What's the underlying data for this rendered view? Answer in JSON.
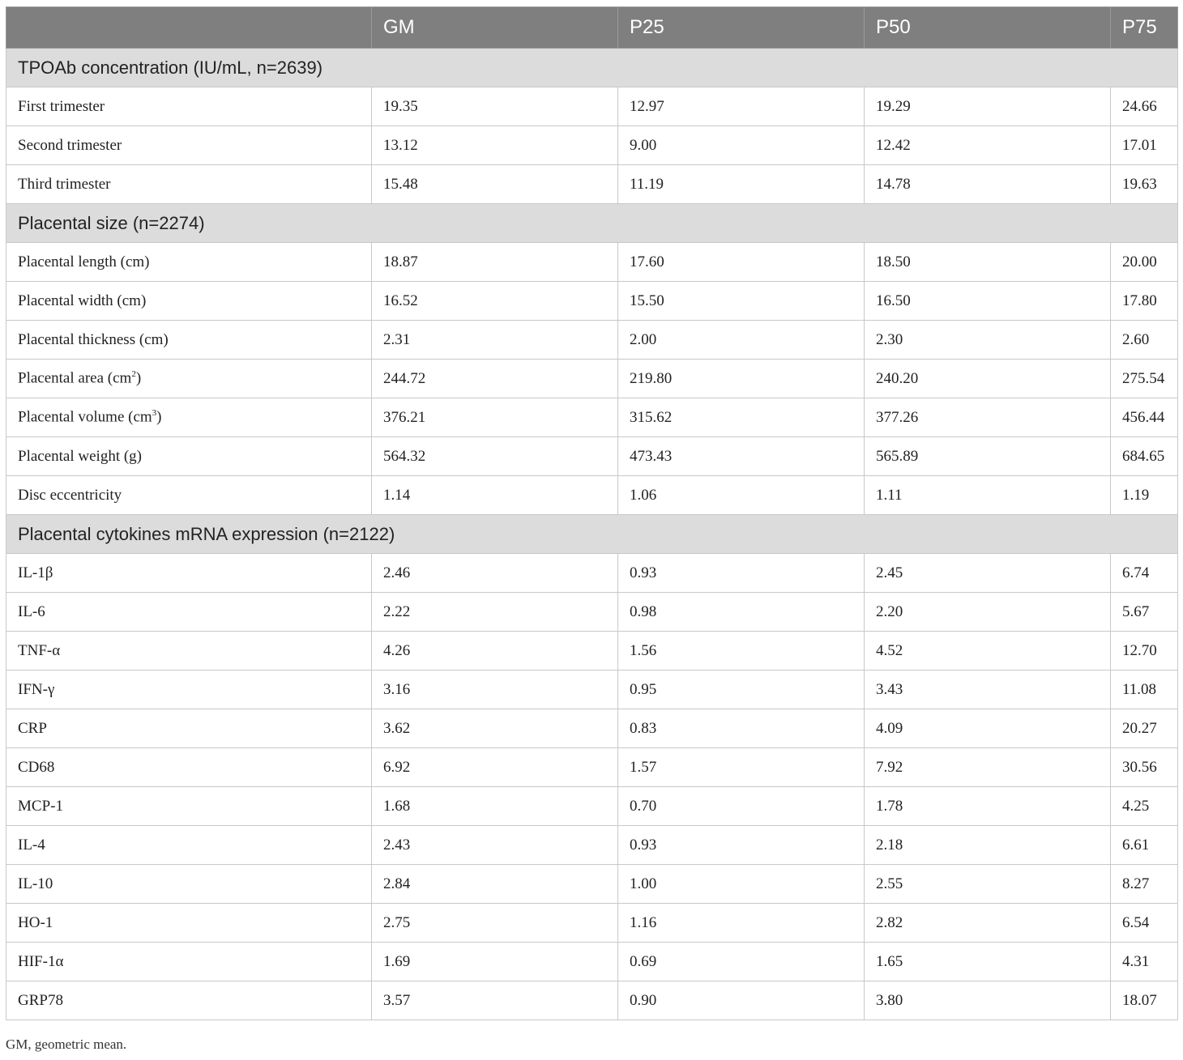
{
  "header": [
    "",
    "GM",
    "P25",
    "P50",
    "P75"
  ],
  "sections": [
    {
      "title": "TPOAb concentration (IU/mL, n=2639)",
      "rows": [
        {
          "label": "First trimester",
          "values": [
            "19.35",
            "12.97",
            "19.29",
            "24.66"
          ]
        },
        {
          "label": "Second trimester",
          "values": [
            "13.12",
            "9.00",
            "12.42",
            "17.01"
          ]
        },
        {
          "label": "Third trimester",
          "values": [
            "15.48",
            "11.19",
            "14.78",
            "19.63"
          ]
        }
      ]
    },
    {
      "title": "Placental size (n=2274)",
      "rows": [
        {
          "label": "Placental length (cm)",
          "values": [
            "18.87",
            "17.60",
            "18.50",
            "20.00"
          ]
        },
        {
          "label": "Placental width (cm)",
          "values": [
            "16.52",
            "15.50",
            "16.50",
            "17.80"
          ]
        },
        {
          "label": "Placental thickness (cm)",
          "values": [
            "2.31",
            "2.00",
            "2.30",
            "2.60"
          ]
        },
        {
          "label": "Placental area (cm",
          "sup": "2",
          "label_end": ")",
          "values": [
            "244.72",
            "219.80",
            "240.20",
            "275.54"
          ]
        },
        {
          "label": "Placental volume (cm",
          "sup": "3",
          "label_end": ")",
          "values": [
            "376.21",
            "315.62",
            "377.26",
            "456.44"
          ]
        },
        {
          "label": "Placental weight (g)",
          "values": [
            "564.32",
            "473.43",
            "565.89",
            "684.65"
          ]
        },
        {
          "label": "Disc eccentricity",
          "values": [
            "1.14",
            "1.06",
            "1.11",
            "1.19"
          ]
        }
      ]
    },
    {
      "title": "Placental cytokines mRNA expression (n=2122)",
      "rows": [
        {
          "label": "IL-1β",
          "values": [
            "2.46",
            "0.93",
            "2.45",
            "6.74"
          ]
        },
        {
          "label": "IL-6",
          "values": [
            "2.22",
            "0.98",
            "2.20",
            "5.67"
          ]
        },
        {
          "label": "TNF-α",
          "values": [
            "4.26",
            "1.56",
            "4.52",
            "12.70"
          ]
        },
        {
          "label": "IFN-γ",
          "values": [
            "3.16",
            "0.95",
            "3.43",
            "11.08"
          ]
        },
        {
          "label": "CRP",
          "values": [
            "3.62",
            "0.83",
            "4.09",
            "20.27"
          ]
        },
        {
          "label": "CD68",
          "values": [
            "6.92",
            "1.57",
            "7.92",
            "30.56"
          ]
        },
        {
          "label": "MCP-1",
          "values": [
            "1.68",
            "0.70",
            "1.78",
            "4.25"
          ]
        },
        {
          "label": "IL-4",
          "values": [
            "2.43",
            "0.93",
            "2.18",
            "6.61"
          ]
        },
        {
          "label": "IL-10",
          "values": [
            "2.84",
            "1.00",
            "2.55",
            "8.27"
          ]
        },
        {
          "label": "HO-1",
          "values": [
            "2.75",
            "1.16",
            "2.82",
            "6.54"
          ]
        },
        {
          "label": "HIF-1α",
          "values": [
            "1.69",
            "0.69",
            "1.65",
            "4.31"
          ]
        },
        {
          "label": "GRP78",
          "values": [
            "3.57",
            "0.90",
            "3.80",
            "18.07"
          ]
        }
      ]
    }
  ],
  "footnote": "GM, geometric mean."
}
